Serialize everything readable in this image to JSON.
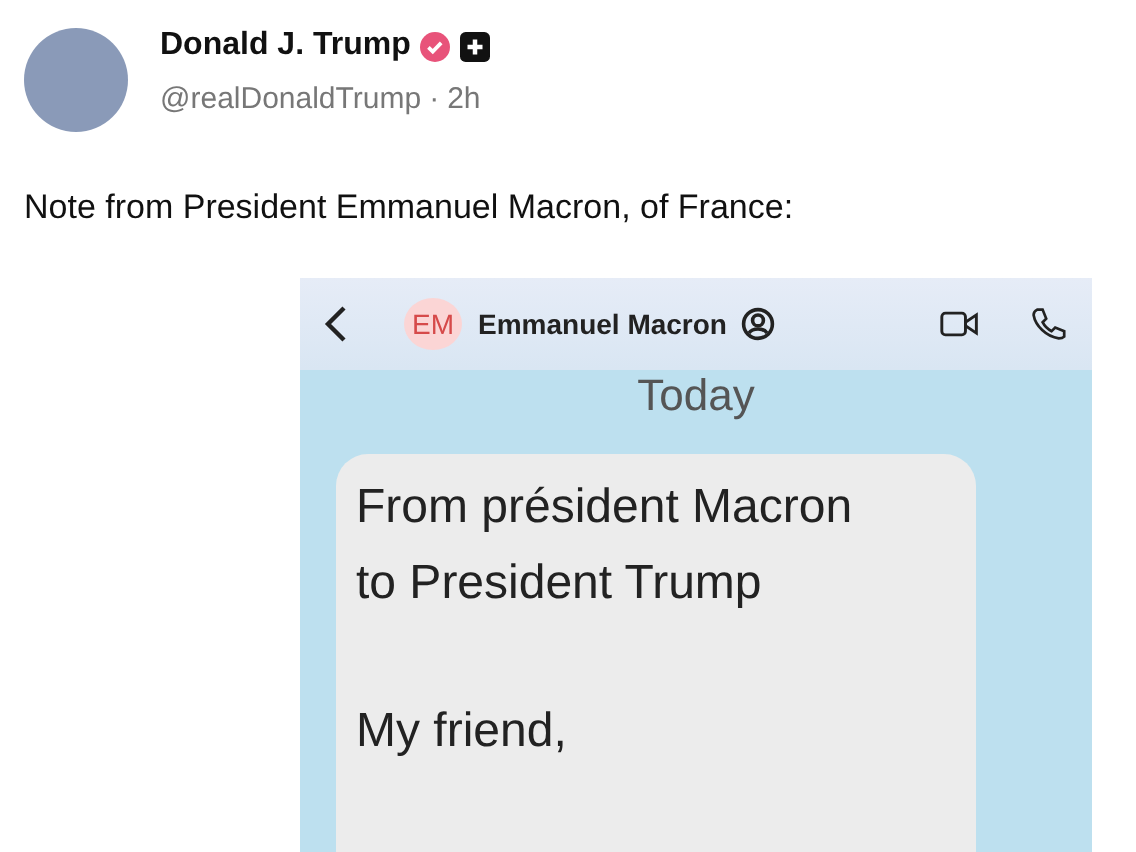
{
  "author": {
    "name": "Donald J. Trump",
    "verified": true,
    "handle": "@realDonaldTrump",
    "separator": "·",
    "time": "2h"
  },
  "post": {
    "text": "Note from President Emmanuel Macron, of France:"
  },
  "embedded_chat": {
    "contact_initials": "EM",
    "contact_name": "Emmanuel Macron",
    "date_label": "Today",
    "message": {
      "paragraphs": [
        "From président Macron\nto President Trump",
        "My friend,"
      ]
    }
  }
}
